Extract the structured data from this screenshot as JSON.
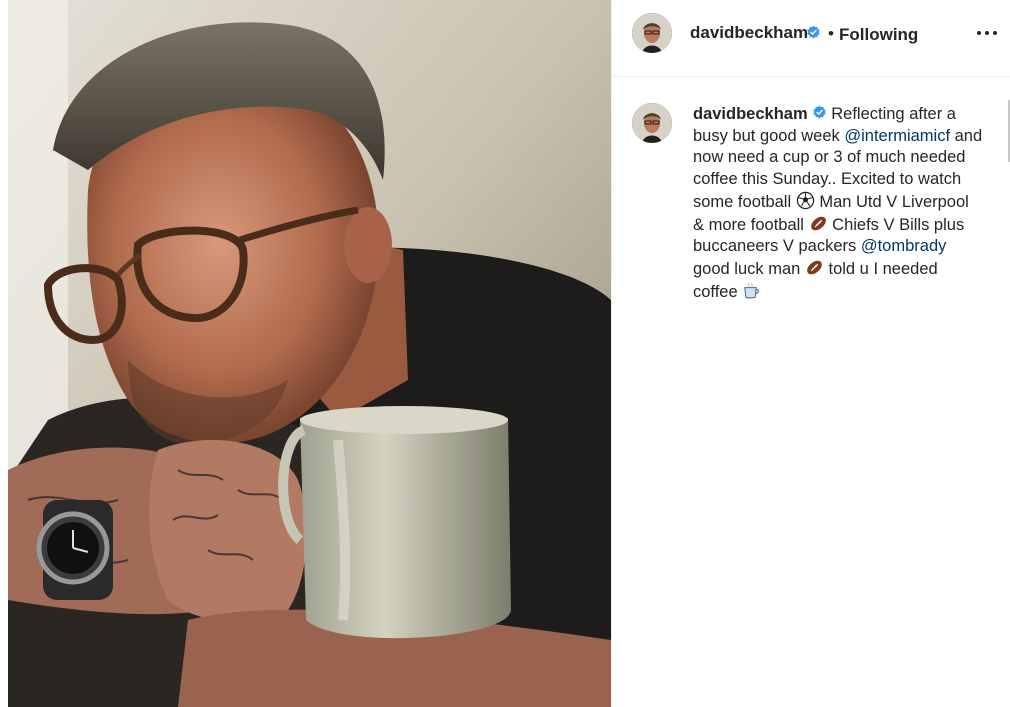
{
  "post": {
    "image_alt": "Man wearing glasses holding a coffee mug",
    "header": {
      "username": "davidbeckham",
      "separator": "•",
      "follow_state": "Following",
      "more_label": "•••"
    },
    "caption": {
      "username": "davidbeckham",
      "segments": [
        {
          "text": "Reflecting after a busy but good week ",
          "type": "text"
        },
        {
          "text": "@intermiamicf",
          "type": "mention"
        },
        {
          "text": " and now need a cup or 3 of much needed coffee this Sunday.. Excited to watch some football ",
          "type": "text"
        },
        {
          "icon": "soccer-ball-emoji",
          "type": "emoji"
        },
        {
          "text": " Man Utd V Liverpool & more football ",
          "type": "text"
        },
        {
          "icon": "american-football-emoji",
          "type": "emoji"
        },
        {
          "text": " Chiefs V Bills plus buccaneers V packers ",
          "type": "text"
        },
        {
          "text": "@tombrady",
          "type": "mention"
        },
        {
          "text": " good luck man ",
          "type": "text"
        },
        {
          "icon": "american-football-emoji",
          "type": "emoji"
        },
        {
          "text": " told u I needed coffee ",
          "type": "text"
        },
        {
          "icon": "hot-beverage-emoji",
          "type": "emoji"
        }
      ]
    },
    "colors": {
      "text": "#262626",
      "mention": "#00376b",
      "verified": "#3897f0",
      "border": "#efefef"
    }
  }
}
